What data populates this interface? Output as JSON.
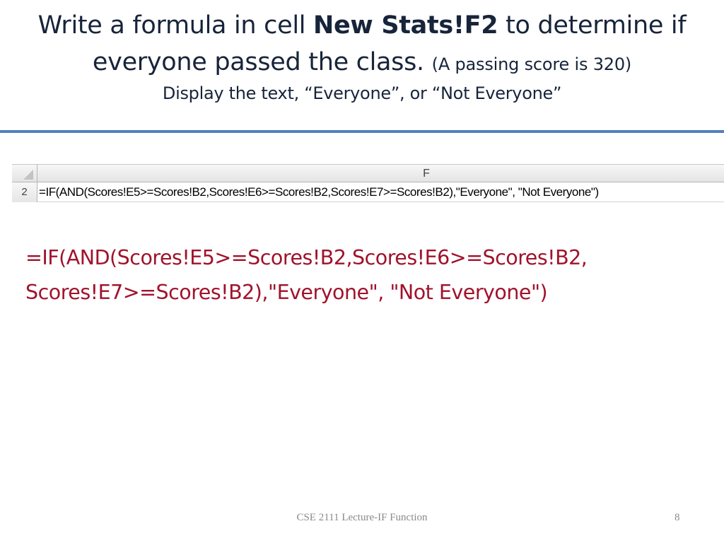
{
  "title": {
    "line1_pre": "Write a formula in cell ",
    "line1_bold": "New Stats!F2",
    "line1_post": " to determine if",
    "line2_main": "everyone passed the class. ",
    "line2_note": "(A passing score is 320)",
    "subtitle": "Display the text, “Everyone”, or “Not Everyone”"
  },
  "spreadsheet": {
    "column_header": "F",
    "row_number": "2",
    "cell_value": "=IF(AND(Scores!E5>=Scores!B2,Scores!E6>=Scores!B2,Scores!E7>=Scores!B2),\"Everyone\", \"Not Everyone\")"
  },
  "formula": {
    "line1": "=IF(AND(Scores!E5>=Scores!B2,Scores!E6>=Scores!B2,",
    "line2": "Scores!E7>=Scores!B2),\"Everyone\", \"Not Everyone\")"
  },
  "footer": {
    "text": "CSE 2111 Lecture-IF Function",
    "page_number": "8"
  },
  "colors": {
    "title": "#17243a",
    "divider": "#4f81bd",
    "formula": "#a0122b",
    "footer": "#8a8a8a"
  }
}
